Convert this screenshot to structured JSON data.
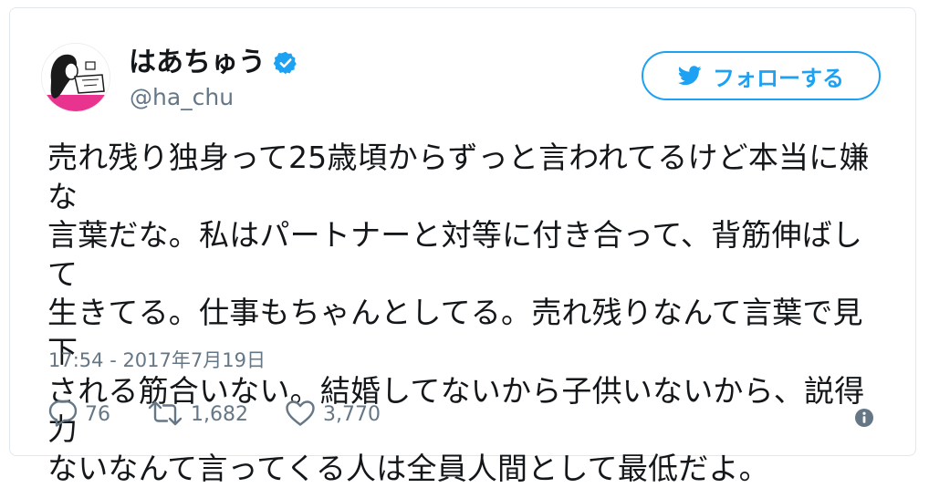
{
  "user": {
    "display_name": "はあちゅう",
    "handle": "@ha_chu"
  },
  "follow_button": {
    "label": "フォローする"
  },
  "tweet": {
    "text": "売れ残り独身って25歳頃からずっと言われてるけど本当に嫌な\n言葉だな。私はパートナーと対等に付き合って、背筋伸ばして\n生きてる。仕事もちゃんとしてる。売れ残りなんて言葉で見下\nされる筋合いない。結婚してないから子供いないから、説得力\nないなんて言ってくる人は全員人間として最低だよ。",
    "timestamp": "17:54 - 2017年7月19日"
  },
  "actions": {
    "replies": "76",
    "retweets": "1,682",
    "likes": "3,770"
  },
  "icons": {
    "verified": "verified-badge-icon",
    "follow": "twitter-bird-icon",
    "reply": "reply-bubble-icon",
    "retweet": "retweet-icon",
    "like": "heart-icon",
    "info": "info-icon"
  },
  "colors": {
    "brand_blue": "#1da1f2",
    "text_primary": "#14171a",
    "text_secondary": "#657786",
    "border": "#e1e8ed",
    "avatar_accent": "#e8348e"
  }
}
